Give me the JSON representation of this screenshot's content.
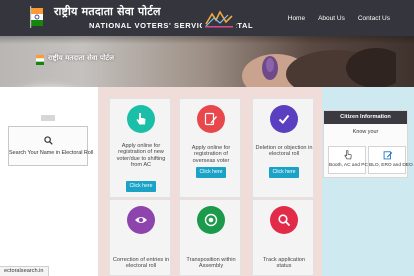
{
  "header": {
    "title_hindi": "राष्ट्रीय मतदाता सेवा पोर्टल",
    "title_english": "NATIONAL VOTERS' SERVICES PORTAL",
    "nav": [
      "Home",
      "About Us",
      "Contact Us"
    ]
  },
  "banner": {
    "text": "राष्ट्रीय मतदाता सेवा पोर्टल"
  },
  "search": {
    "label": "Search Your Name in Electoral Roll",
    "icon": "search-icon"
  },
  "cards_row1": [
    {
      "label": "Apply online for registration of new voter/due to shifting from AC",
      "button": "Click here",
      "color": "#1bbfa8",
      "icon": "hand-pointer-icon"
    },
    {
      "label": "Apply online for registration of overseas voter",
      "button": "Click here",
      "color": "#e8474c",
      "icon": "pencil-icon"
    },
    {
      "label": "Deletion or objection in electoral roll",
      "button": "Click here",
      "color": "#5a3fc0",
      "icon": "checkmark-icon"
    }
  ],
  "cards_row2": [
    {
      "label": "Correction of entries in electoral roll",
      "color": "#8e44ad",
      "icon": "eye-icon"
    },
    {
      "label": "Transposition within Assembly",
      "color": "#1a9a4a",
      "icon": "target-icon"
    },
    {
      "label": "Track application status",
      "color": "#e22b49",
      "icon": "search-icon"
    }
  ],
  "citizen": {
    "title": "Citizen Information",
    "subtitle": "Know your",
    "tiles": [
      {
        "label": "Booth, AC and PC",
        "icon": "hand-pointer-icon"
      },
      {
        "label": "BLO, ERO and DEO",
        "icon": "edit-icon"
      }
    ]
  },
  "status_bar": {
    "text": "ectoralsearch.in"
  },
  "colors": {
    "header_bg": "#35353d",
    "button": "#1aa3c6",
    "main_bg": "#f0dcd9",
    "right_bg": "#cfe9f1"
  }
}
